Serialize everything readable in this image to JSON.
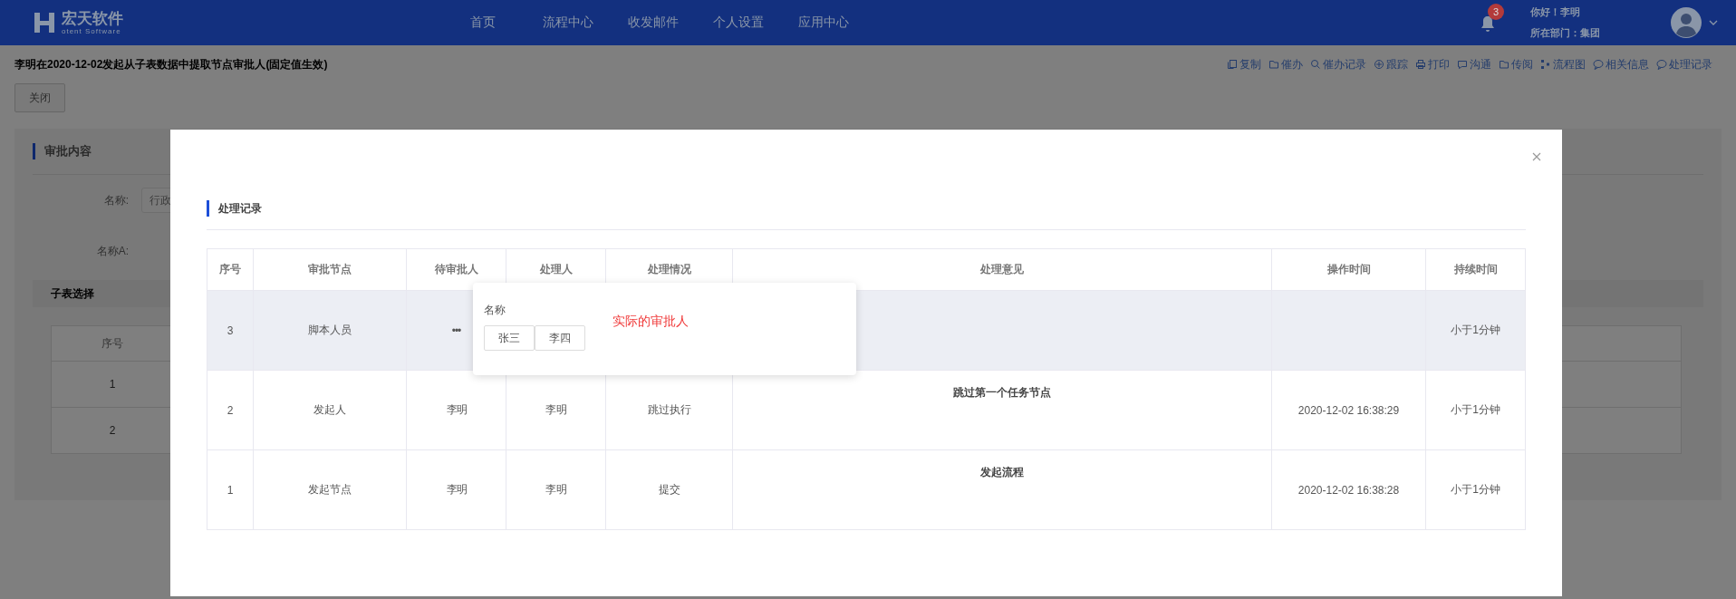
{
  "header": {
    "logo_text": "宏天软件",
    "logo_subtext": "otent Software",
    "nav": [
      "首页",
      "流程中心",
      "收发邮件",
      "个人设置",
      "应用中心"
    ],
    "notification_count": "3",
    "greeting": "你好！李明",
    "department": "所在部门：集团"
  },
  "page": {
    "title": "李明在2020-12-02发起从子表数据中提取节点审批人(固定值生效)",
    "toolbar": [
      {
        "label": "复制",
        "kind": "copy"
      },
      {
        "label": "催办",
        "kind": "folder"
      },
      {
        "label": "催办记录",
        "kind": "search"
      },
      {
        "label": "跟踪",
        "kind": "target"
      },
      {
        "label": "打印",
        "kind": "print"
      },
      {
        "label": "沟通",
        "kind": "chat"
      },
      {
        "label": "传阅",
        "kind": "folder"
      },
      {
        "label": "流程图",
        "kind": "flow"
      },
      {
        "label": "相关信息",
        "kind": "bubble"
      },
      {
        "label": "处理记录",
        "kind": "bubble"
      }
    ],
    "close_button": "关闭",
    "panel": {
      "title": "审批内容",
      "fields": [
        {
          "label": "名称:",
          "value": "行政"
        },
        {
          "label": "名称A:"
        }
      ],
      "subtable": {
        "title": "子表选择",
        "columns": [
          "序号"
        ],
        "rows": [
          [
            "1"
          ],
          [
            "2"
          ]
        ]
      }
    }
  },
  "modal": {
    "section_title": "处理记录",
    "columns": [
      "序号",
      "审批节点",
      "待审批人",
      "处理人",
      "处理情况",
      "处理意见",
      "操作时间",
      "持续时间"
    ],
    "rows": [
      {
        "seq": "3",
        "node": "脚本人员",
        "pending": "•••",
        "highlighted": true,
        "duration": "小于1分钟"
      },
      {
        "seq": "2",
        "node": "发起人",
        "pending": "李明",
        "handler": "李明",
        "status": "跳过执行",
        "opinion": "跳过第一个任务节点",
        "time": "2020-12-02 16:38:29",
        "highlighted": false,
        "duration": "小于1分钟"
      },
      {
        "seq": "1",
        "node": "发起节点",
        "pending": "李明",
        "handler": "李明",
        "status": "提交",
        "opinion": "发起流程",
        "time": "2020-12-02 16:38:28",
        "highlighted": false,
        "duration": "小于1分钟"
      }
    ],
    "popover": {
      "label": "名称",
      "tags": [
        "张三",
        "李四"
      ],
      "note": "实际的审批人"
    }
  }
}
